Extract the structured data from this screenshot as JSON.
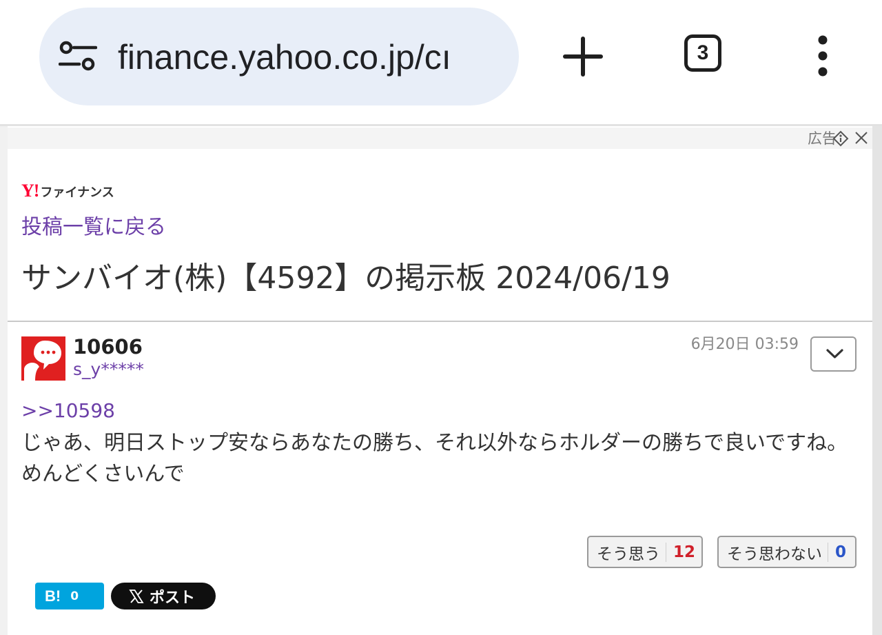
{
  "browser": {
    "url": "finance.yahoo.co.jp/cı",
    "tab_count": "3",
    "icons": {
      "site_info": "tune-icon",
      "new_tab": "plus-icon",
      "menu": "more-vert-icon"
    }
  },
  "ad": {
    "label": "広告",
    "icons": {
      "adchoices": "adchoices-icon",
      "close": "close-icon"
    }
  },
  "site": {
    "logo_mark": "Y!",
    "logo_text": "ファイナンス"
  },
  "nav": {
    "back_label": "投稿一覧に戻る"
  },
  "board": {
    "title": "サンバイオ(株)【4592】の掲示板 2024/06/19"
  },
  "post": {
    "number": "10606",
    "author": "s_y*****",
    "timestamp": "6月20日 03:59",
    "reply_to": ">>10598",
    "body": "じゃあ、明日ストップ安ならあなたの勝ち、それ以外ならホルダーの勝ちで良いですね。めんどくさいんで",
    "reactions": {
      "agree": {
        "label": "そう思う",
        "count": "12"
      },
      "disagree": {
        "label": "そう思わない",
        "count": "0"
      }
    }
  },
  "share": {
    "hatena": {
      "label": "B!",
      "count": "0"
    },
    "x_post": {
      "label": "ポスト"
    }
  },
  "colors": {
    "link_purple": "#6c3fa8",
    "yahoo_red": "#ff0033",
    "hatena_blue": "#00a4de",
    "agree_count": "#d0202a",
    "disagree_count": "#2a55c8",
    "url_bar_bg": "#e8eef8"
  }
}
